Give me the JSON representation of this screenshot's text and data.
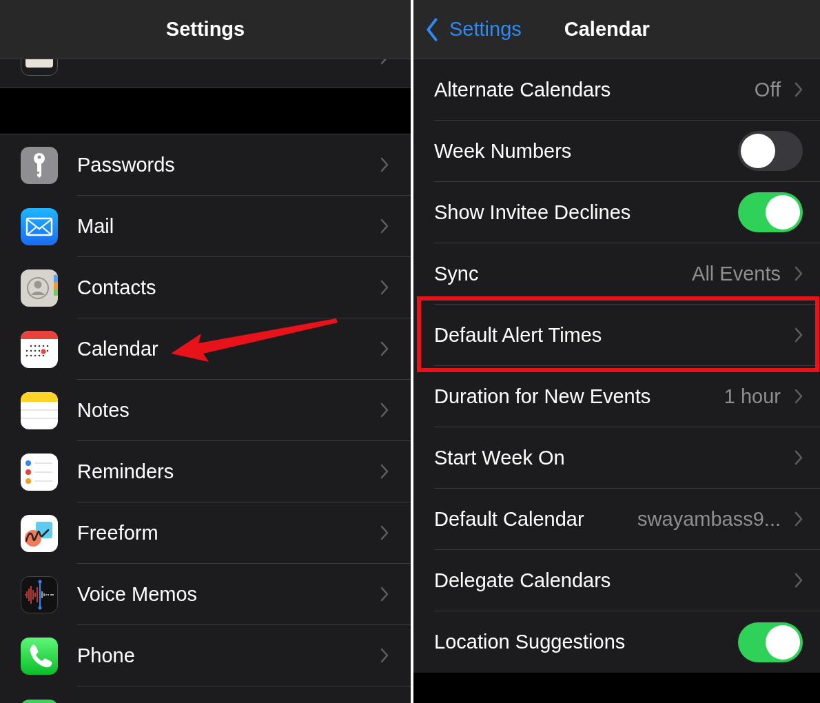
{
  "left_panel": {
    "title": "Settings",
    "items": [
      {
        "label": "Passwords"
      },
      {
        "label": "Mail"
      },
      {
        "label": "Contacts"
      },
      {
        "label": "Calendar"
      },
      {
        "label": "Notes"
      },
      {
        "label": "Reminders"
      },
      {
        "label": "Freeform"
      },
      {
        "label": "Voice Memos"
      },
      {
        "label": "Phone"
      }
    ]
  },
  "right_panel": {
    "back_label": "Settings",
    "title": "Calendar",
    "rows": [
      {
        "kind": "link",
        "label": "Alternate Calendars",
        "value": "Off"
      },
      {
        "kind": "toggle",
        "label": "Week Numbers",
        "on": false
      },
      {
        "kind": "toggle",
        "label": "Show Invitee Declines",
        "on": true
      },
      {
        "kind": "link",
        "label": "Sync",
        "value": "All Events"
      },
      {
        "kind": "link",
        "label": "Default Alert Times"
      },
      {
        "kind": "link",
        "label": "Duration for New Events",
        "value": "1 hour"
      },
      {
        "kind": "link",
        "label": "Start Week On"
      },
      {
        "kind": "link",
        "label": "Default Calendar",
        "value": "swayambass9..."
      },
      {
        "kind": "link",
        "label": "Delegate Calendars"
      },
      {
        "kind": "toggle",
        "label": "Location Suggestions",
        "on": true
      }
    ]
  }
}
